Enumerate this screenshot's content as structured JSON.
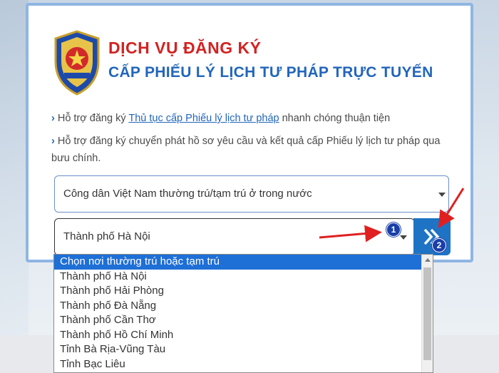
{
  "header": {
    "title_line1": "DỊCH VỤ ĐĂNG KÝ",
    "title_line2": "CẤP PHIẾU LÝ LỊCH TƯ PHÁP TRỰC TUYẾN"
  },
  "info": {
    "line1_prefix": "Hỗ trợ đăng ký ",
    "line1_link": "Thủ tục cấp Phiếu lý lịch tư pháp",
    "line1_suffix": " nhanh chóng thuận tiện",
    "line2": "Hỗ trợ đăng ký chuyển phát hồ sơ yêu cầu và kết quả cấp Phiếu lý lịch tư pháp qua bưu chính."
  },
  "form": {
    "citizen_type_value": "Công dân Việt Nam thường trú/tạm trú ở trong nước",
    "residence_value": "Thành phố Hà Nội",
    "badge1": "1",
    "badge2": "2"
  },
  "dropdown": {
    "options": [
      "Chọn nơi thường trú hoặc tạm trú",
      "Thành phố Hà Nội",
      "Thành phố Hải Phòng",
      "Thành phố Đà Nẵng",
      "Thành phố Cần Thơ",
      "Thành phố Hồ Chí Minh",
      "Tỉnh Bà Rịa-Vũng Tàu",
      "Tỉnh Bạc Liêu"
    ],
    "selected_index": 0
  },
  "colors": {
    "title_red": "#d32222",
    "title_blue": "#2266bb",
    "button_blue": "#1e73c4",
    "annotation_red": "#e02020"
  },
  "icons": {
    "logo": "police-emblem-icon",
    "go": "double-chevron-right-icon",
    "dropdown": "caret-down-icon"
  }
}
